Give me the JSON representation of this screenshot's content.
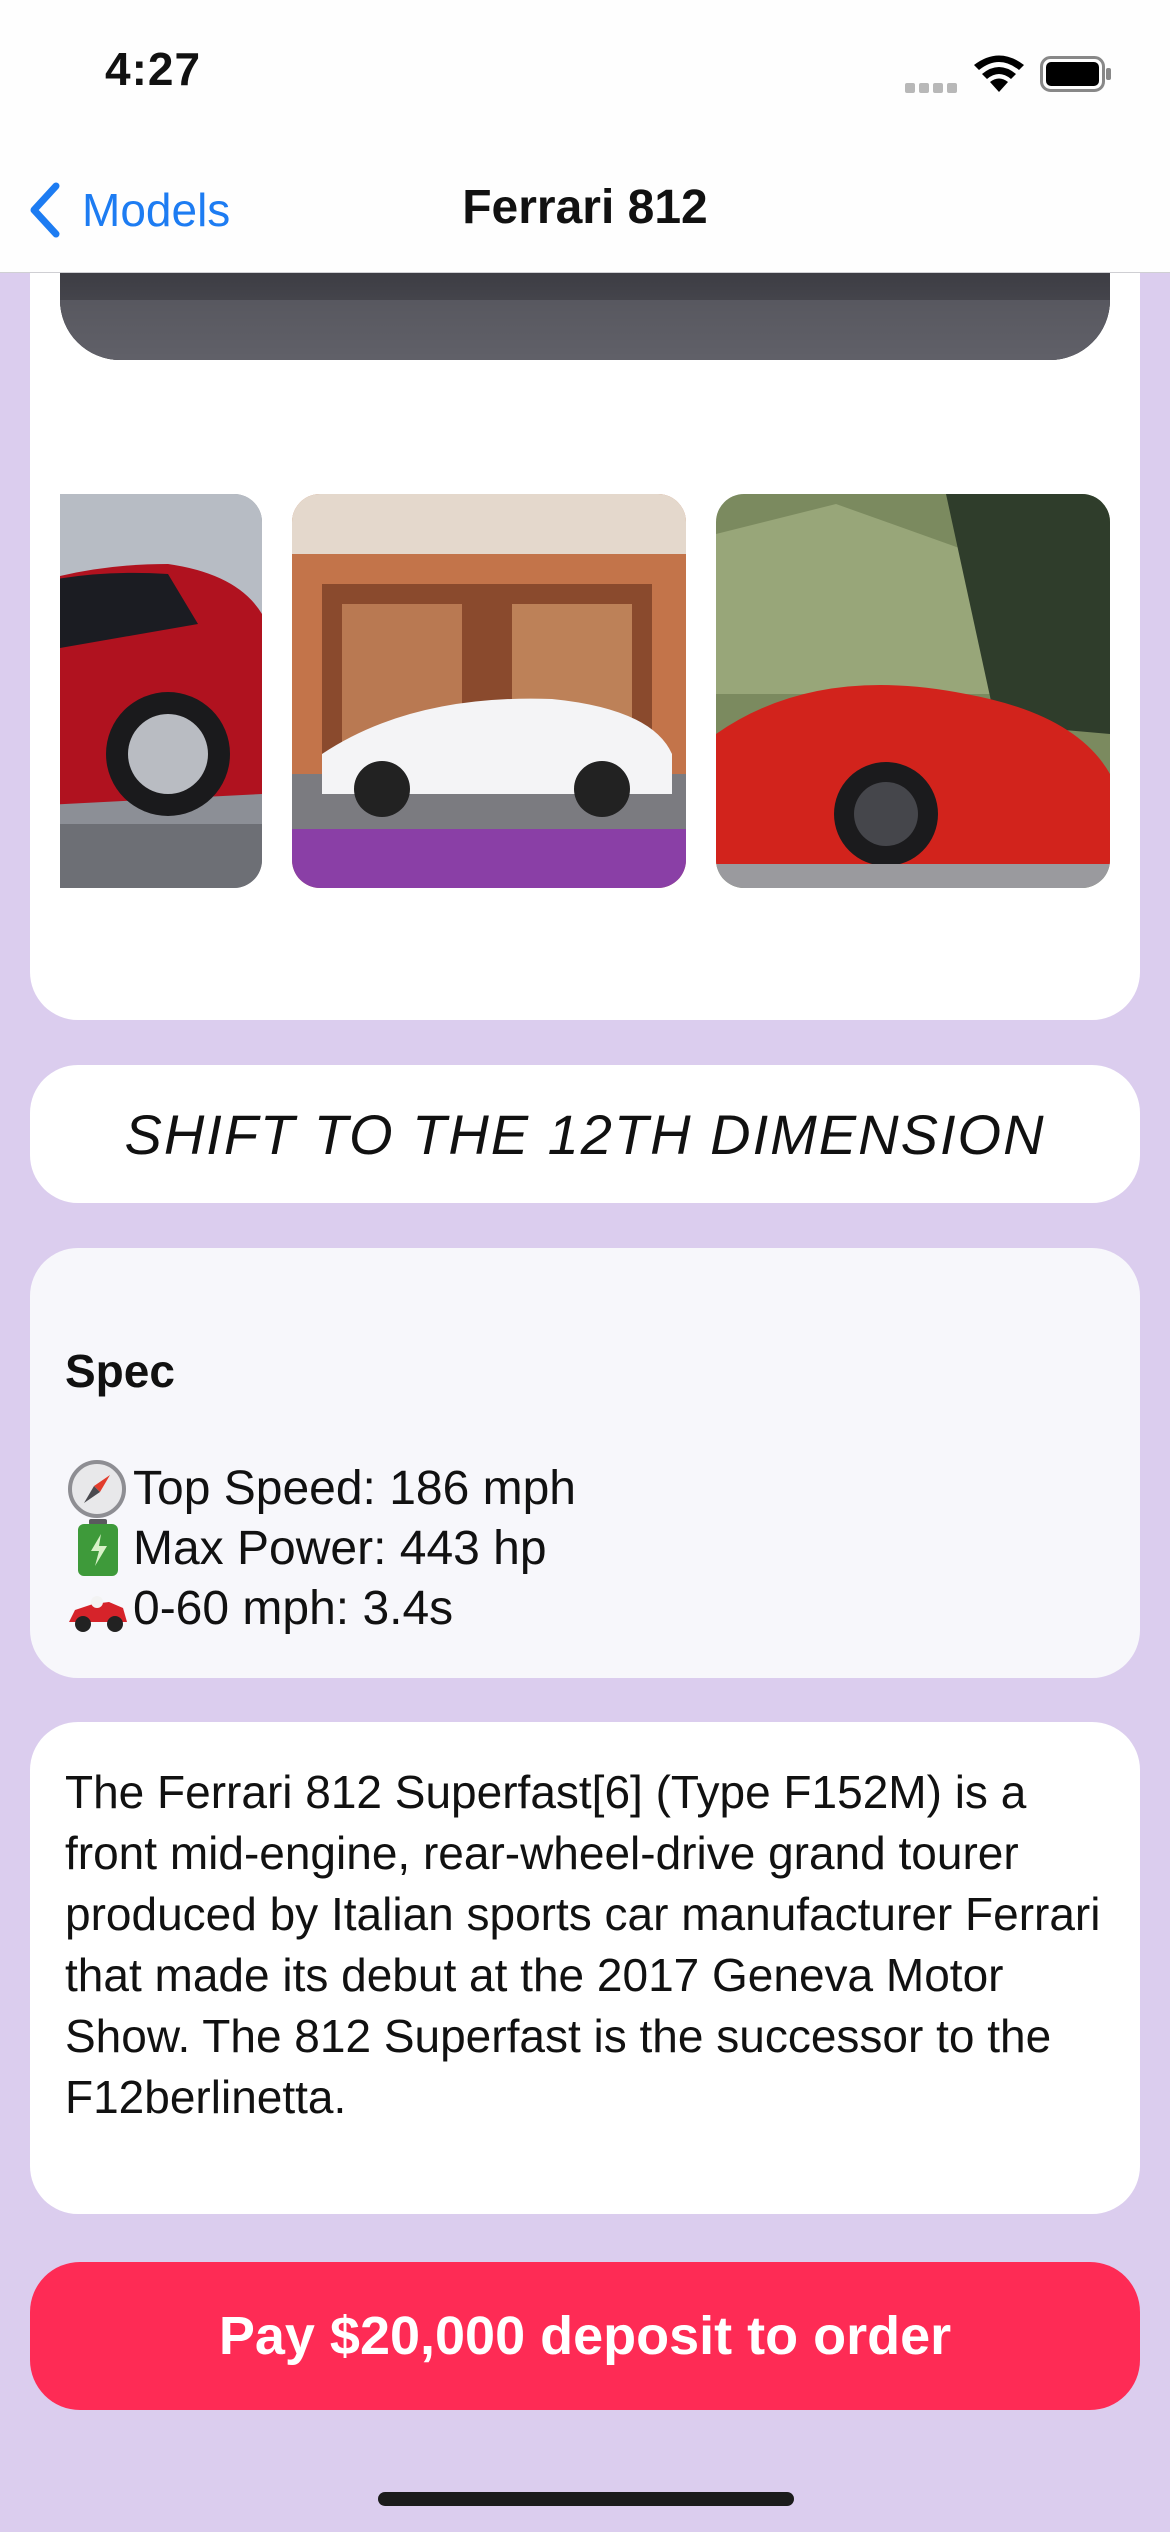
{
  "status_bar": {
    "time": "4:27"
  },
  "nav": {
    "back_label": "Models",
    "title": "Ferrari 812"
  },
  "hero": {
    "image": "ferrari-812-hero-photo"
  },
  "gallery": {
    "images": [
      "red-ferrari-812-driving",
      "white-ferrari-812-storefront",
      "red-ferrari-mountains"
    ]
  },
  "tagline": "SHIFT TO THE 12TH DIMENSION",
  "spec": {
    "title": "Spec",
    "items": [
      {
        "icon": "compass-icon",
        "text": "Top Speed: 186 mph"
      },
      {
        "icon": "battery-icon",
        "text": "Max Power: 443 hp"
      },
      {
        "icon": "race-car-icon",
        "text": "0-60 mph: 3.4s"
      }
    ]
  },
  "description": "The Ferrari 812 Superfast[6] (Type F152M) is a front mid-engine, rear-wheel-drive grand tourer produced by Italian sports car manufacturer Ferrari that made its debut at the 2017 Geneva Motor Show. The 812 Superfast is the successor to the F12berlinetta.",
  "cta": {
    "label": "Pay $20,000 deposit to order"
  },
  "colors": {
    "accent": "#1d7cf2",
    "background": "#dbcdee",
    "cta": "#fe2b55"
  }
}
